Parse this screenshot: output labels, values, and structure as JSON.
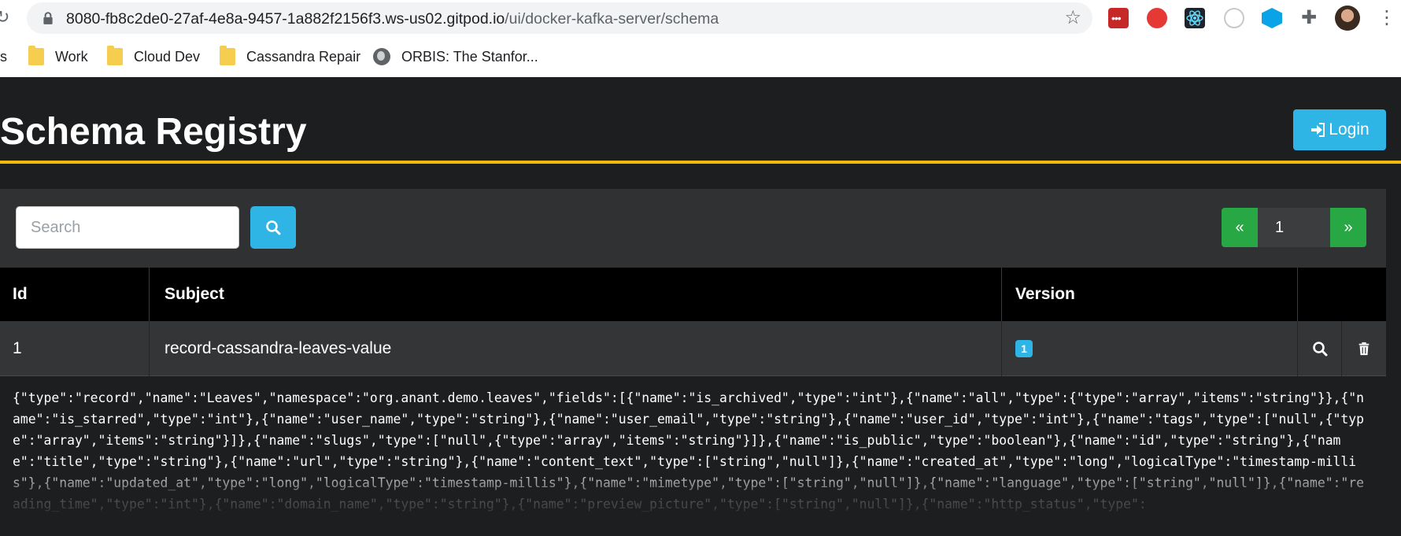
{
  "browser": {
    "url_host": "8080-fb8c2de0-27af-4e8a-9457-1a882f2156f3.ws-us02.gitpod.io",
    "url_path": "/ui/docker-kafka-server/schema",
    "icons": {
      "reload": "reload-icon",
      "lock": "lock-icon",
      "star": "star-icon",
      "extensions": "puzzle-icon",
      "menu": "kebab-menu-icon"
    },
    "bookmarks": {
      "cut_label": "s",
      "work": "Work",
      "cloud_dev": "Cloud Dev",
      "cassandra_repair": "Cassandra Repair",
      "orbis": "ORBIS: The Stanfor..."
    }
  },
  "app": {
    "title": "Schema Registry",
    "login_label": "Login",
    "search": {
      "placeholder": "Search",
      "value": ""
    },
    "pagination": {
      "prev": "«",
      "page": "1",
      "next": "»"
    },
    "table": {
      "headers": {
        "id": "Id",
        "subject": "Subject",
        "version": "Version"
      },
      "row": {
        "id": "1",
        "subject": "record-cassandra-leaves-value",
        "version": "1"
      },
      "schema": "{\"type\":\"record\",\"name\":\"Leaves\",\"namespace\":\"org.anant.demo.leaves\",\"fields\":[{\"name\":\"is_archived\",\"type\":\"int\"},{\"name\":\"all\",\"type\":{\"type\":\"array\",\"items\":\"string\"}},{\"name\":\"is_starred\",\"type\":\"int\"},{\"name\":\"user_name\",\"type\":\"string\"},{\"name\":\"user_email\",\"type\":\"string\"},{\"name\":\"user_id\",\"type\":\"int\"},{\"name\":\"tags\",\"type\":[\"null\",{\"type\":\"array\",\"items\":\"string\"}]},{\"name\":\"slugs\",\"type\":[\"null\",{\"type\":\"array\",\"items\":\"string\"}]},{\"name\":\"is_public\",\"type\":\"boolean\"},{\"name\":\"id\",\"type\":\"string\"},{\"name\":\"title\",\"type\":\"string\"},{\"name\":\"url\",\"type\":\"string\"},{\"name\":\"content_text\",\"type\":[\"string\",\"null\"]},{\"name\":\"created_at\",\"type\":\"long\",\"logicalType\":\"timestamp-millis\"},{\"name\":\"updated_at\",\"type\":\"long\",\"logicalType\":\"timestamp-millis\"},{\"name\":\"mimetype\",\"type\":[\"string\",\"null\"]},{\"name\":\"language\",\"type\":[\"string\",\"null\"]},{\"name\":\"reading_time\",\"type\":\"int\"},{\"name\":\"domain_name\",\"type\":\"string\"},{\"name\":\"preview_picture\",\"type\":[\"string\",\"null\"]},{\"name\":\"http_status\",\"type\":"
    }
  },
  "colors": {
    "accent": "#f0b90b",
    "primary": "#2fb4e6",
    "success": "#27a844",
    "background": "#1d1e1f"
  }
}
